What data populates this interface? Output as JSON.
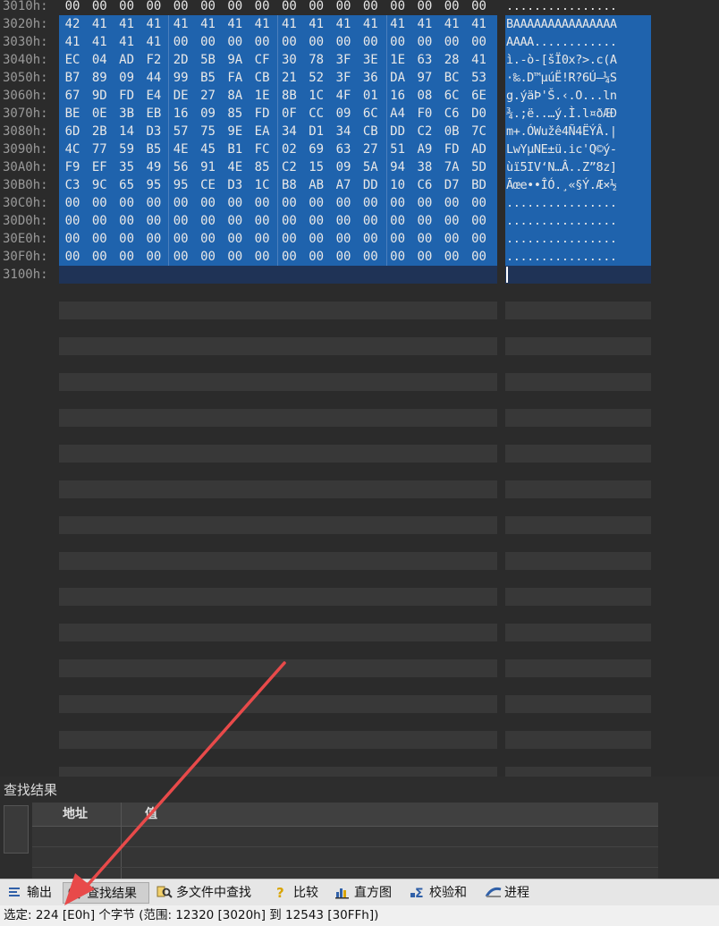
{
  "hex_view": {
    "partial_top_row": {
      "address": "3010h:",
      "bytes": [
        "00",
        "00",
        "00",
        "00",
        "00",
        "00",
        "00",
        "00",
        "00",
        "00",
        "00",
        "00",
        "00",
        "00",
        "00",
        "00"
      ],
      "ascii": "................"
    },
    "rows": [
      {
        "address": "3020h:",
        "bytes": [
          "42",
          "41",
          "41",
          "41",
          "41",
          "41",
          "41",
          "41",
          "41",
          "41",
          "41",
          "41",
          "41",
          "41",
          "41",
          "41"
        ],
        "ascii": "BAAAAAAAAAAAAAAA"
      },
      {
        "address": "3030h:",
        "bytes": [
          "41",
          "41",
          "41",
          "41",
          "00",
          "00",
          "00",
          "00",
          "00",
          "00",
          "00",
          "00",
          "00",
          "00",
          "00",
          "00"
        ],
        "ascii": "AAAA............"
      },
      {
        "address": "3040h:",
        "bytes": [
          "EC",
          "04",
          "AD",
          "F2",
          "2D",
          "5B",
          "9A",
          "CF",
          "30",
          "78",
          "3F",
          "3E",
          "1E",
          "63",
          "28",
          "41"
        ],
        "ascii": "ì.-ò-[šÏ0x?>.c(A"
      },
      {
        "address": "3050h:",
        "bytes": [
          "B7",
          "89",
          "09",
          "44",
          "99",
          "B5",
          "FA",
          "CB",
          "21",
          "52",
          "3F",
          "36",
          "DA",
          "97",
          "BC",
          "53"
        ],
        "ascii": "·‰.D™µúË!R?6Ú—¼S"
      },
      {
        "address": "3060h:",
        "bytes": [
          "67",
          "9D",
          "FD",
          "E4",
          "DE",
          "27",
          "8A",
          "1E",
          "8B",
          "1C",
          "4F",
          "01",
          "16",
          "08",
          "6C",
          "6E"
        ],
        "ascii": "g.ýäÞ'Š.‹.O...ln"
      },
      {
        "address": "3070h:",
        "bytes": [
          "BE",
          "0E",
          "3B",
          "EB",
          "16",
          "09",
          "85",
          "FD",
          "0F",
          "CC",
          "09",
          "6C",
          "A4",
          "F0",
          "C6",
          "D0"
        ],
        "ascii": "¾.;ë..…ý.Ì.l¤ðÆÐ"
      },
      {
        "address": "3080h:",
        "bytes": [
          "6D",
          "2B",
          "14",
          "D3",
          "57",
          "75",
          "9E",
          "EA",
          "34",
          "D1",
          "34",
          "CB",
          "DD",
          "C2",
          "0B",
          "7C"
        ],
        "ascii": "m+.ÓWužê4Ñ4ËÝÂ.|"
      },
      {
        "address": "3090h:",
        "bytes": [
          "4C",
          "77",
          "59",
          "B5",
          "4E",
          "45",
          "B1",
          "FC",
          "02",
          "69",
          "63",
          "27",
          "51",
          "A9",
          "FD",
          "AD"
        ],
        "ascii": "LwYµNE±ü.ic'Q©ý-"
      },
      {
        "address": "30A0h:",
        "bytes": [
          "F9",
          "EF",
          "35",
          "49",
          "56",
          "91",
          "4E",
          "85",
          "C2",
          "15",
          "09",
          "5A",
          "94",
          "38",
          "7A",
          "5D"
        ],
        "ascii": "ùï5IV‘N…Â..Z”8z]"
      },
      {
        "address": "30B0h:",
        "bytes": [
          "C3",
          "9C",
          "65",
          "95",
          "95",
          "CE",
          "D3",
          "1C",
          "B8",
          "AB",
          "A7",
          "DD",
          "10",
          "C6",
          "D7",
          "BD"
        ],
        "ascii": "Ãœe••ÎÓ.¸«§Ý.Æ×½"
      },
      {
        "address": "30C0h:",
        "bytes": [
          "00",
          "00",
          "00",
          "00",
          "00",
          "00",
          "00",
          "00",
          "00",
          "00",
          "00",
          "00",
          "00",
          "00",
          "00",
          "00"
        ],
        "ascii": "................"
      },
      {
        "address": "30D0h:",
        "bytes": [
          "00",
          "00",
          "00",
          "00",
          "00",
          "00",
          "00",
          "00",
          "00",
          "00",
          "00",
          "00",
          "00",
          "00",
          "00",
          "00"
        ],
        "ascii": "................"
      },
      {
        "address": "30E0h:",
        "bytes": [
          "00",
          "00",
          "00",
          "00",
          "00",
          "00",
          "00",
          "00",
          "00",
          "00",
          "00",
          "00",
          "00",
          "00",
          "00",
          "00"
        ],
        "ascii": "................"
      },
      {
        "address": "30F0h:",
        "bytes": [
          "00",
          "00",
          "00",
          "00",
          "00",
          "00",
          "00",
          "00",
          "00",
          "00",
          "00",
          "00",
          "00",
          "00",
          "00",
          "00"
        ],
        "ascii": "................"
      }
    ],
    "cursor_row": {
      "address": "3100h:"
    },
    "colors": {
      "selection": "#1f63ad",
      "cursor_row": "#1f3356",
      "stripe": "#383838",
      "background": "#2b2b2b"
    }
  },
  "find_panel": {
    "title": "查找结果",
    "columns": [
      "地址",
      "值"
    ]
  },
  "tabs": [
    {
      "label": "输出",
      "icon": "output-icon",
      "active": false
    },
    {
      "label": "查找结果",
      "icon": "find-results-icon",
      "active": true
    },
    {
      "label": "多文件中查找",
      "icon": "multi-file-find-icon",
      "active": false
    },
    {
      "label": "比较",
      "icon": "compare-icon",
      "active": false
    },
    {
      "label": "直方图",
      "icon": "histogram-icon",
      "active": false
    },
    {
      "label": "校验和",
      "icon": "checksum-icon",
      "active": false
    },
    {
      "label": "进程",
      "icon": "process-icon",
      "active": false
    }
  ],
  "status": {
    "text": "选定: 224 [E0h] 个字节 (范围: 12320 [3020h] 到 12543 [30FFh])"
  },
  "annotation": {
    "arrow_color": "#e84a4a"
  }
}
